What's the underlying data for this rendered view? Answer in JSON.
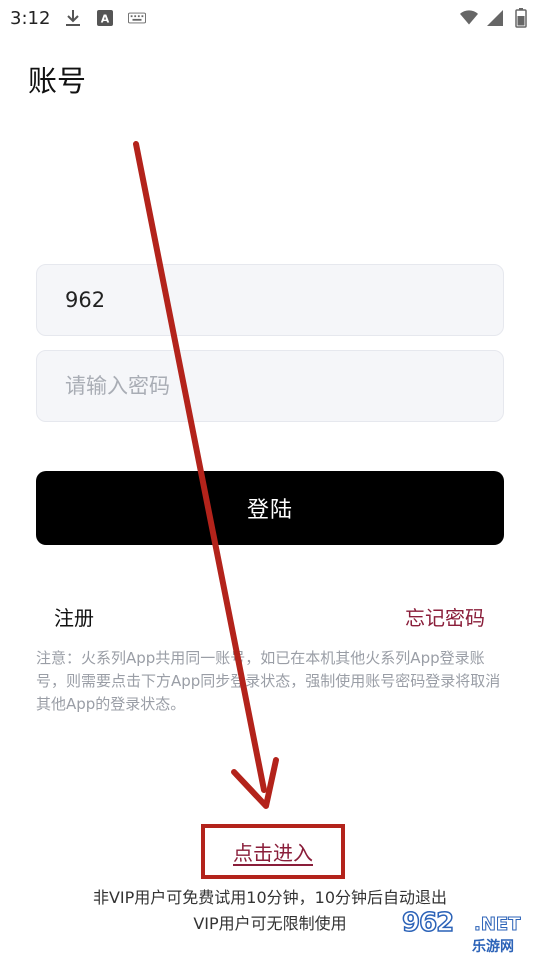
{
  "status_bar": {
    "time": "3:12",
    "icons": [
      "download-icon",
      "a-keyboard-icon",
      "keyboard-icon",
      "wifi-icon",
      "signal-icon",
      "battery-icon"
    ]
  },
  "page": {
    "title": "账号"
  },
  "form": {
    "username_value": "962",
    "password_placeholder": "请输入密码",
    "login_label": "登陆"
  },
  "links": {
    "register": "注册",
    "forgot": "忘记密码"
  },
  "notice": "注意：火系列App共用同一账号，如已在本机其他火系列App登录账号，则需要点击下方App同步登录状态，强制使用账号密码登录将取消其他App的登录状态。",
  "enter": {
    "label": "点击进入"
  },
  "trial": {
    "line1": "非VIP用户可免费试用10分钟，10分钟后自动退出",
    "line2": "VIP用户可无限制使用"
  },
  "watermark": {
    "brand": "962",
    "suffix": ".NET",
    "sub": "乐游网"
  },
  "colors": {
    "accent": "#8a1e3a",
    "annotation_red": "#b3231b",
    "button_bg": "#000000"
  }
}
